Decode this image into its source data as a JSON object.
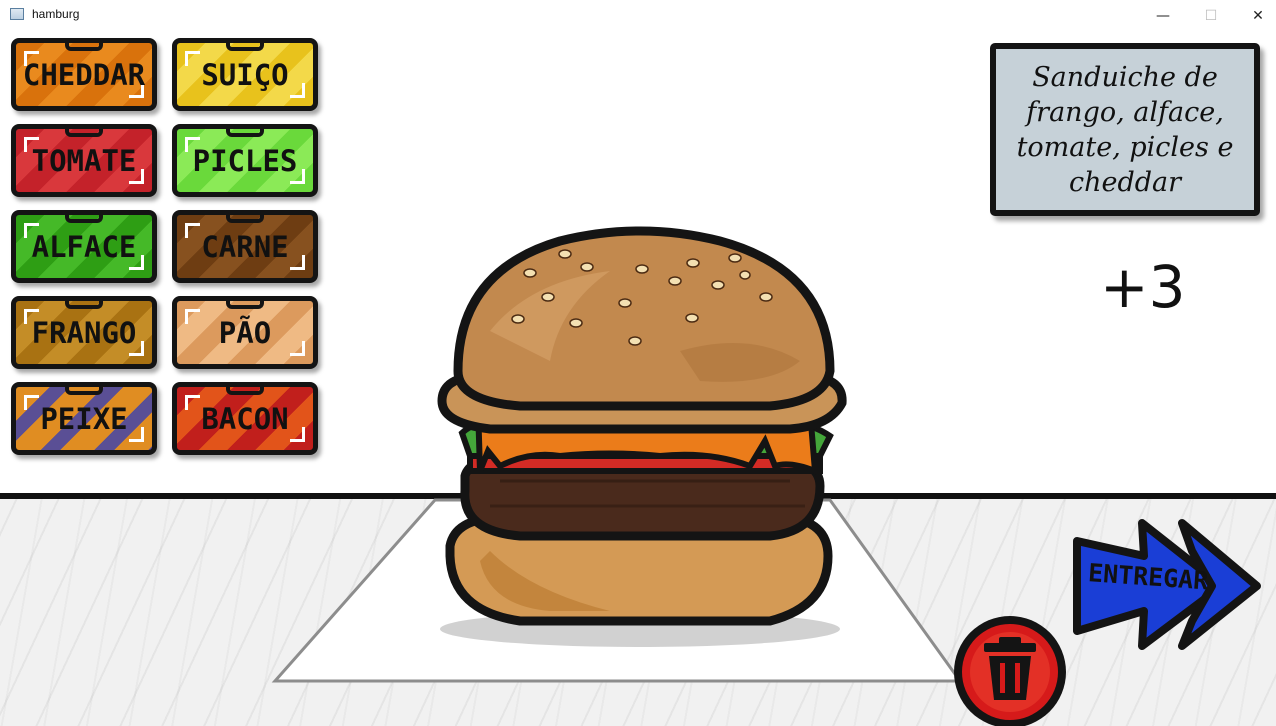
{
  "window": {
    "title": "hamburg",
    "controls": {
      "minimize": "—",
      "maximize": "☐",
      "close": "✕"
    }
  },
  "ingredients": [
    {
      "label": "CHEDDAR",
      "theme": "orange"
    },
    {
      "label": "SUIÇO",
      "theme": "yellow"
    },
    {
      "label": "TOMATE",
      "theme": "red"
    },
    {
      "label": "PICLES",
      "theme": "lime"
    },
    {
      "label": "ALFACE",
      "theme": "green"
    },
    {
      "label": "CARNE",
      "theme": "brown"
    },
    {
      "label": "FRANGO",
      "theme": "gold"
    },
    {
      "label": "PÃO",
      "theme": "peach"
    },
    {
      "label": "PEIXE",
      "theme": "fish"
    },
    {
      "label": "BACON",
      "theme": "bacon"
    }
  ],
  "order": {
    "text": "Sanduiche de frango, alface, tomate, picles e cheddar"
  },
  "score": "+3",
  "burger_layers": [
    "bun-top",
    "cheddar",
    "lettuce",
    "tomato",
    "patty",
    "bun-bottom"
  ],
  "actions": {
    "deliver_label": "ENTREGAR",
    "trash_icon": "trash-icon"
  },
  "colors": {
    "order_card": "#c6d1d8",
    "deliver_arrow": "#1a3ed6",
    "trash_button": "#d61a1a",
    "outline": "#141414"
  }
}
